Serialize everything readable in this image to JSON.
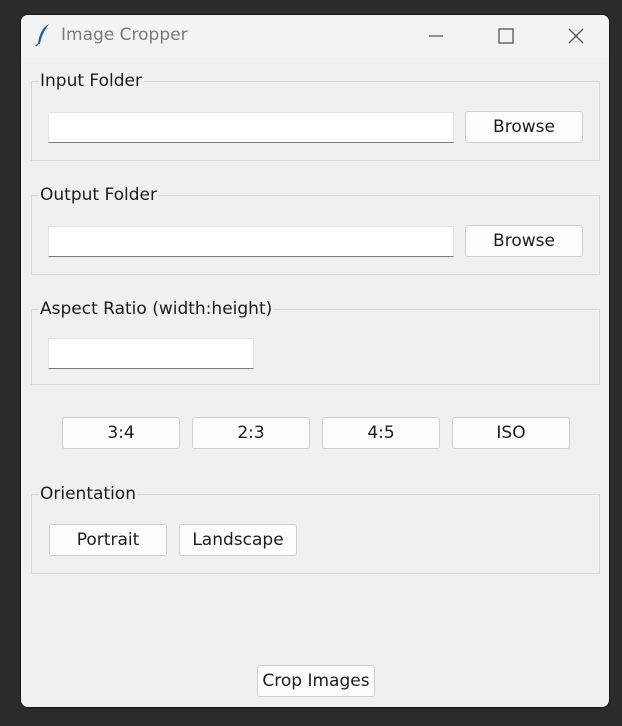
{
  "window": {
    "title": "Image Cropper",
    "icon": "feather-icon",
    "controls": [
      "minimize-icon",
      "maximize-icon",
      "close-icon"
    ]
  },
  "input_folder": {
    "label": "Input Folder",
    "value": "",
    "browse_label": "Browse"
  },
  "output_folder": {
    "label": "Output Folder",
    "value": "",
    "browse_label": "Browse"
  },
  "aspect_ratio": {
    "label": "Aspect Ratio (width:height)",
    "value": "",
    "presets": [
      "3:4",
      "2:3",
      "4:5",
      "ISO"
    ]
  },
  "orientation": {
    "label": "Orientation",
    "options": [
      "Portrait",
      "Landscape"
    ]
  },
  "crop_button_label": "Crop Images",
  "colors": {
    "window_bg": "#f0f0f0",
    "desktop_bg": "#2b2b2b",
    "feather": "#2b5aa8"
  }
}
